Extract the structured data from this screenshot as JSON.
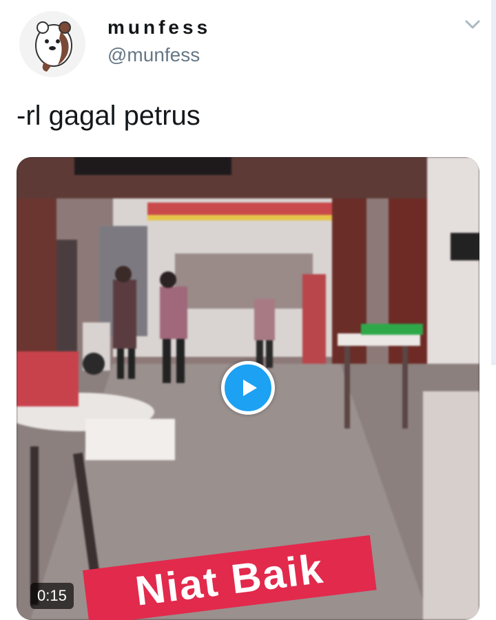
{
  "tweet": {
    "display_name": "munfess",
    "handle": "@munfess",
    "text": "-rl gagal petrus",
    "avatar_icon": "bear-avatar-icon",
    "menu_icon": "chevron-down-icon"
  },
  "media": {
    "duration": "0:15",
    "overlay_text": "Niat Baik",
    "play_icon": "play-icon",
    "accent_color": "#1da1f2",
    "banner_color": "#e22a4c"
  }
}
